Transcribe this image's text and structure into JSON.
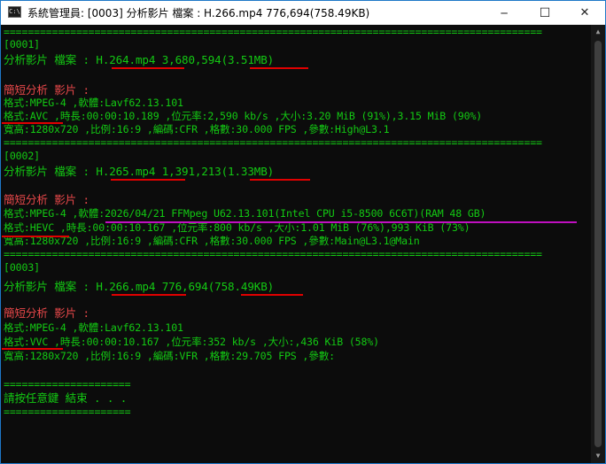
{
  "window": {
    "title": "系統管理員: [0003] 分析影片 檔案 : H.266.mp4 776,694(758.49KB)",
    "app_icon": "C:\\",
    "buttons": {
      "minimize": "─",
      "maximize": "☐",
      "close": "✕"
    }
  },
  "console": {
    "lines": [
      "=========================================================================================",
      "[0001]",
      "分析影片 檔案 : H.264.mp4 3,680,594(3.51MB)",
      "",
      "簡短分析 影片 :",
      "格式:MPEG-4 ,軟體:Lavf62.13.101",
      "格式:AVC ,時長:00:00:10.189 ,位元率:2,590 kb/s ,大小:3.20 MiB (91%),3.15 MiB (90%)",
      "寬高:1280x720 ,比例:16:9 ,編碼:CFR ,格數:30.000 FPS ,參數:High@L3.1",
      "=========================================================================================",
      "[0002]",
      "分析影片 檔案 : H.265.mp4 1,391,213(1.33MB)",
      "",
      "簡短分析 影片 :",
      "格式:MPEG-4 ,軟體:2026/04/21 FFMpeg U62.13.101(Intel CPU i5-8500 6C6T)(RAM 48 GB)",
      "格式:HEVC ,時長:00:00:10.167 ,位元率:800 kb/s ,大小:1.01 MiB (76%),993 KiB (73%)",
      "寬高:1280x720 ,比例:16:9 ,編碼:CFR ,格數:30.000 FPS ,參數:Main@L3.1@Main",
      "=========================================================================================",
      "[0003]",
      "分析影片 檔案 : H.266.mp4 776,694(758.49KB)",
      "",
      "簡短分析 影片 :",
      "格式:MPEG-4 ,軟體:Lavf62.13.101",
      "格式:VVC ,時長:00:00:10.167 ,位元率:352 kb/s ,大小:,436 KiB (58%)",
      "寬高:1280x720 ,比例:16:9 ,編碼:VFR ,格數:29.705 FPS ,參數:",
      "",
      "=====================",
      "請按任意鍵 結束 . . .",
      "====================="
    ]
  }
}
